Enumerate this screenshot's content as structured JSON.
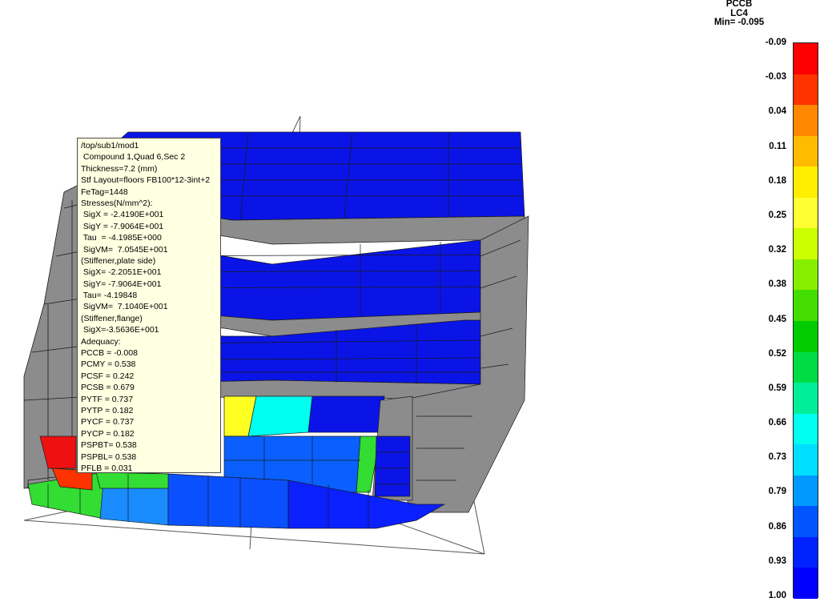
{
  "tooltip": {
    "lines": [
      "/top/sub1/mod1",
      " Compound 1,Quad 6,Sec 2",
      "Thickness=7.2 (mm)",
      "Stf Layout=floors FB100*12-3int+2",
      "FeTag=1448",
      "Stresses(N/mm^2):",
      " SigX = -2.4190E+001",
      " SigY = -7.9064E+001",
      " Tau  = -4.1985E+000",
      " SigVM=  7.0545E+001",
      "(Stiffener,plate side)",
      " SigX= -2.2051E+001",
      " SigY= -7.9064E+001",
      " Tau= -4.19848",
      " SigVM=  7.1040E+001",
      "(Stiffener,flange)",
      " SigX=-3.5636E+001",
      "Adequacy:",
      "PCCB = -0.008",
      "PCMY = 0.538",
      "PCSF = 0.242",
      "PCSB = 0.679",
      "PYTF = 0.737",
      "PYTP = 0.182",
      "PYCF = 0.737",
      "PYCP = 0.182",
      "PSPBT= 0.538",
      "PSPBL= 0.538",
      "PFLB = 0.031"
    ]
  },
  "legend": {
    "title_line1": "PCCB",
    "title_line2": "LC4",
    "min_label": "Min= -0.095",
    "ticks": [
      "-0.09",
      "-0.03",
      "0.04",
      "0.11",
      "0.18",
      "0.25",
      "0.32",
      "0.38",
      "0.45",
      "0.52",
      "0.59",
      "0.66",
      "0.73",
      "0.79",
      "0.86",
      "0.93",
      "1.00"
    ],
    "colors": [
      "#ff0000",
      "#ff3300",
      "#ff8800",
      "#ffbb00",
      "#ffee00",
      "#ffff33",
      "#ccff00",
      "#88ee00",
      "#44dd00",
      "#00cc00",
      "#00dd44",
      "#00ee99",
      "#00ffee",
      "#00ddff",
      "#0099ff",
      "#0055ff",
      "#0022ff",
      "#0000ff"
    ]
  },
  "model": {
    "colors": {
      "deck_blue": "#0a14e6",
      "structure_gray": "#8c8c8c",
      "edge": "#1a1a1a",
      "frame_line": "#555555"
    }
  }
}
